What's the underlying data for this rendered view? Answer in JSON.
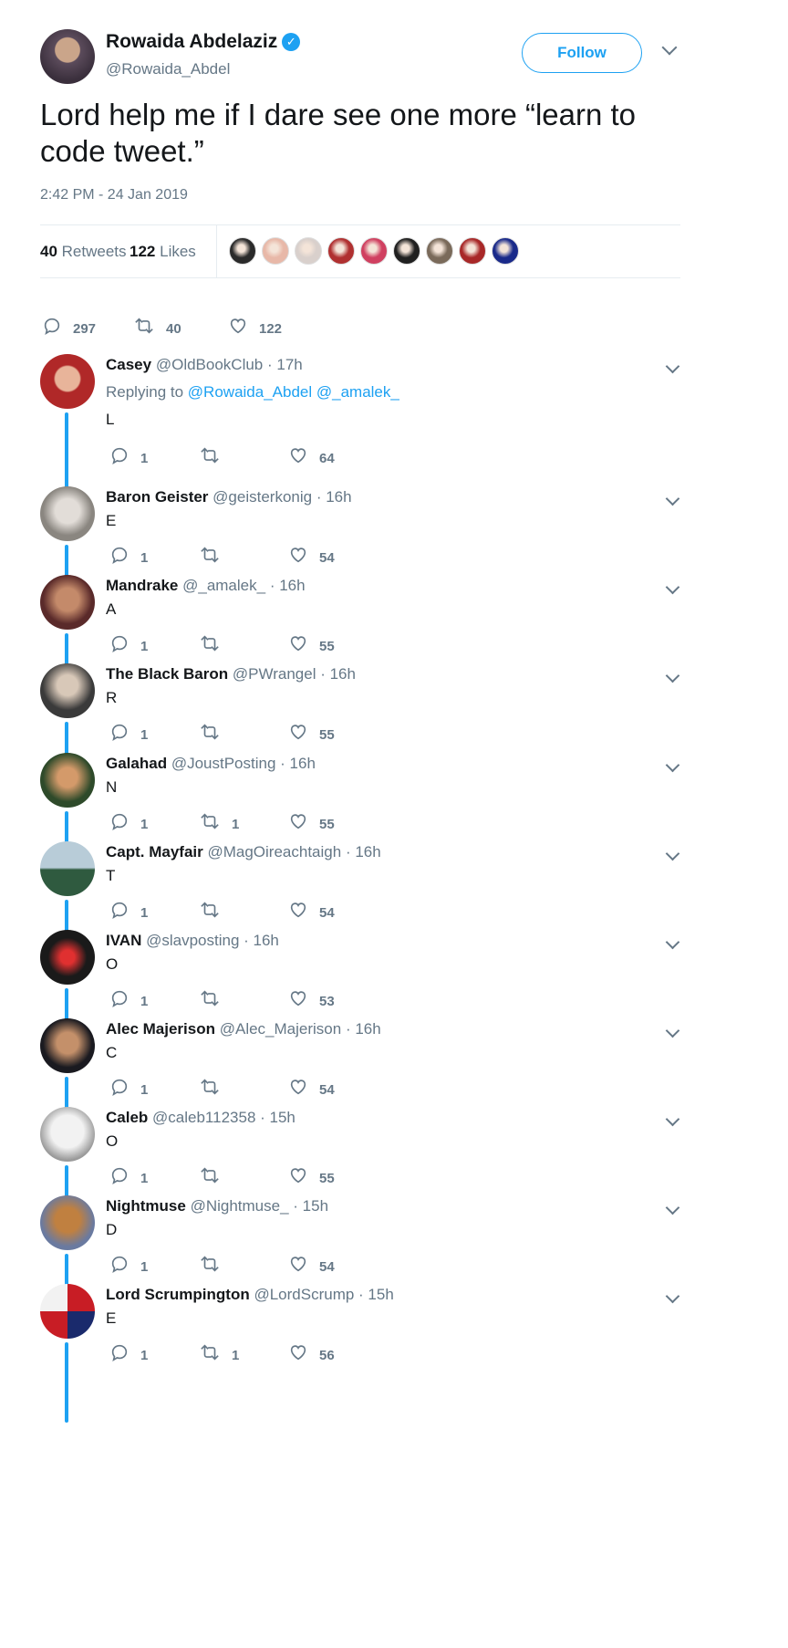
{
  "tweet": {
    "author_name": "Rowaida Abdelaziz",
    "author_handle": "@Rowaida_Abdel",
    "follow_label": "Follow",
    "text": "Lord help me if I dare see one more “learn to code tweet.”",
    "timestamp": "2:42 PM - 24 Jan 2019",
    "retweets_count": "40",
    "retweets_label": "Retweets",
    "likes_count": "122",
    "likes_label": "Likes",
    "reply_action_count": "297",
    "retweet_action_count": "40",
    "like_action_count": "122",
    "liker_colors": [
      "#2a2a2a",
      "#e8b8a8",
      "#d9d0cc",
      "#b03030",
      "#d04060",
      "#202020",
      "#7a6a5a",
      "#a82828",
      "#1a2a8a"
    ]
  },
  "replies": [
    {
      "name": "Casey",
      "handle": "@OldBookClub",
      "time": "· 17h",
      "replying_label": "Replying to",
      "replying_to_1": "@Rowaida_Abdel",
      "replying_to_2": "@_amalek_",
      "text": "L",
      "replies": "1",
      "retweets": "",
      "likes": "64"
    },
    {
      "name": "Baron Geister",
      "handle": "@geisterkonig",
      "time": "· 16h",
      "text": "E",
      "replies": "1",
      "retweets": "",
      "likes": "54"
    },
    {
      "name": "Mandrake",
      "handle": "@_amalek_",
      "time": "· 16h",
      "text": "A",
      "replies": "1",
      "retweets": "",
      "likes": "55"
    },
    {
      "name": "The Black Baron",
      "handle": "@PWrangel",
      "time": "· 16h",
      "text": "R",
      "replies": "1",
      "retweets": "",
      "likes": "55"
    },
    {
      "name": "Galahad",
      "handle": "@JoustPosting",
      "time": "· 16h",
      "text": "N",
      "replies": "1",
      "retweets": "1",
      "likes": "55"
    },
    {
      "name": "Capt. Mayfair",
      "handle": "@MagOireachtaigh",
      "time": "· 16h",
      "text": "T",
      "replies": "1",
      "retweets": "",
      "likes": "54"
    },
    {
      "name": "IVAN",
      "handle": "@slavposting",
      "time": "· 16h",
      "text": "O",
      "replies": "1",
      "retweets": "",
      "likes": "53"
    },
    {
      "name": "Alec Majerison",
      "handle": "@Alec_Majerison",
      "time": "· 16h",
      "text": "C",
      "replies": "1",
      "retweets": "",
      "likes": "54"
    },
    {
      "name": "Caleb",
      "handle": "@caleb112358",
      "time": "· 15h",
      "text": "O",
      "replies": "1",
      "retweets": "",
      "likes": "55"
    },
    {
      "name": "Nightmuse",
      "handle": "@Nightmuse_",
      "time": "· 15h",
      "text": "D",
      "replies": "1",
      "retweets": "",
      "likes": "54"
    },
    {
      "name": "Lord Scrumpington",
      "handle": "@LordScrump",
      "time": "· 15h",
      "text": "E",
      "replies": "1",
      "retweets": "1",
      "likes": "56"
    }
  ],
  "colors": {
    "accent": "#1da1f2",
    "muted": "#657786",
    "text": "#14171a",
    "divider": "#e6ecf0"
  }
}
